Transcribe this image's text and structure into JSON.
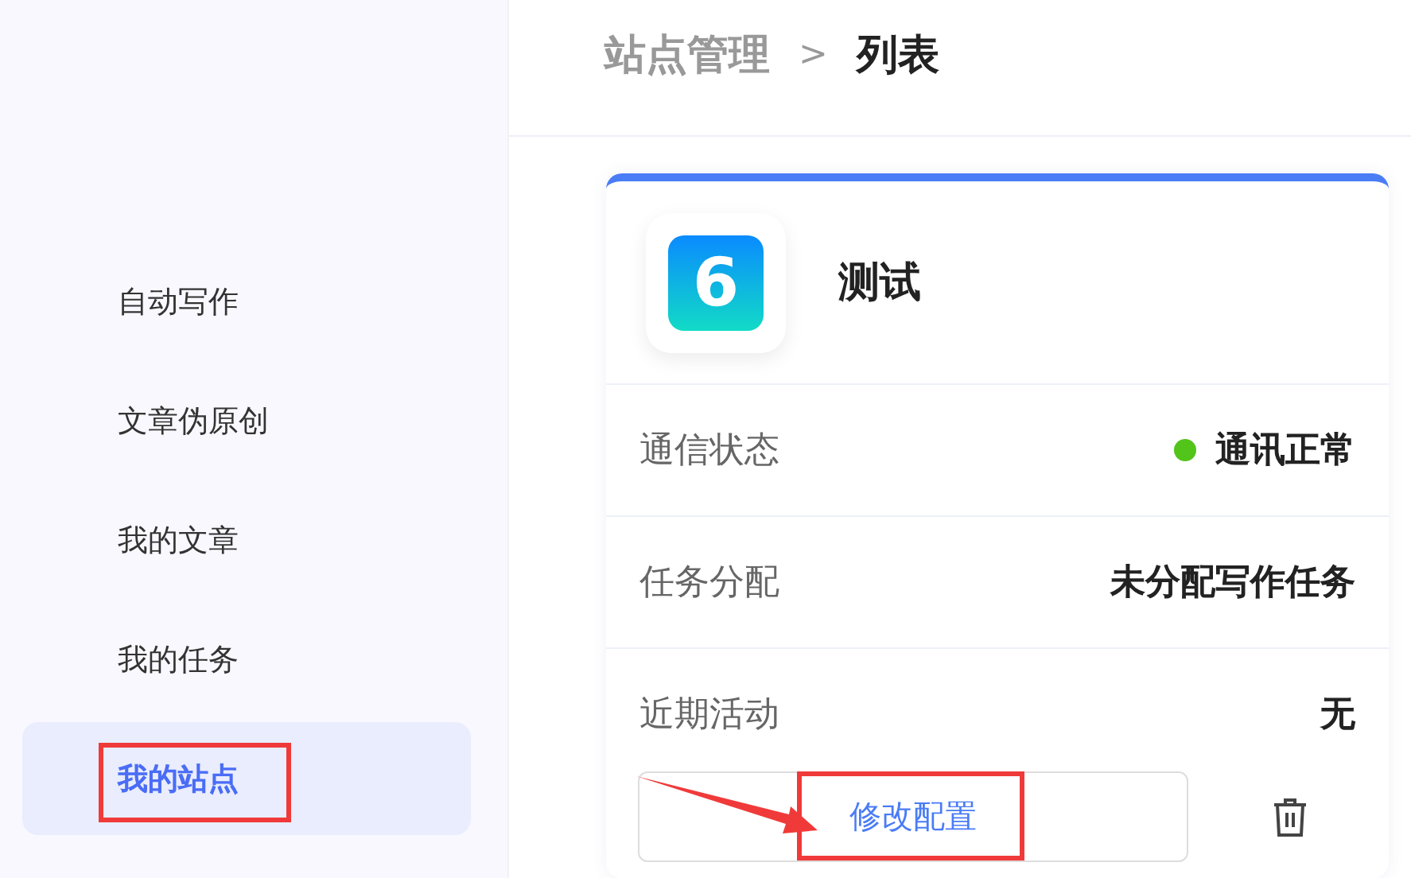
{
  "sidebar": {
    "items": [
      {
        "label": "自动写作",
        "selected": false,
        "highlighted": false
      },
      {
        "label": "文章伪原创",
        "selected": false,
        "highlighted": false
      },
      {
        "label": "我的文章",
        "selected": false,
        "highlighted": false
      },
      {
        "label": "我的任务",
        "selected": false,
        "highlighted": false
      },
      {
        "label": "我的站点",
        "selected": true,
        "highlighted": true
      }
    ]
  },
  "breadcrumb": [
    "站点管理",
    ">",
    "列表"
  ],
  "site_card": {
    "logo_text": "6",
    "name": "测试",
    "fields": [
      {
        "kind": "status",
        "label": "通信状态",
        "value": "通讯正常",
        "color": "#52c41a"
      },
      {
        "kind": "text",
        "label": "任务分配",
        "value": "未分配写作任务"
      },
      {
        "kind": "text",
        "label": "近期活动",
        "value": "无"
      }
    ],
    "config_button": {
      "label": "修改配置",
      "highlighted": true,
      "pointer_arrow": true
    }
  }
}
